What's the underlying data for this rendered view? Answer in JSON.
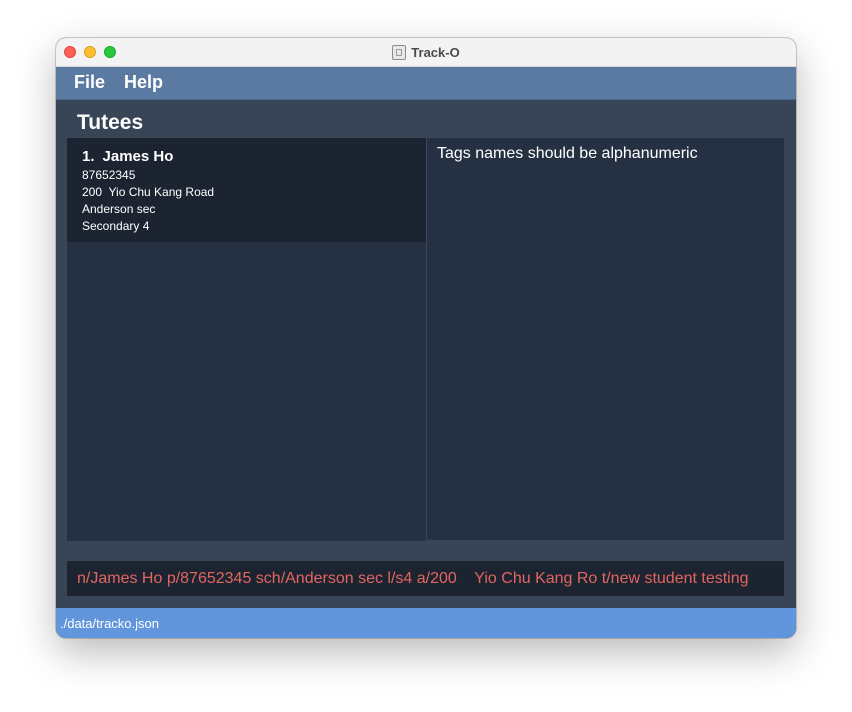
{
  "window": {
    "title": "Track-O"
  },
  "menubar": {
    "items": [
      {
        "label": "File"
      },
      {
        "label": "Help"
      }
    ]
  },
  "tutees_panel": {
    "heading": "Tutees",
    "tutees": [
      {
        "index": "1.",
        "name": "James Ho",
        "phone": "87652345",
        "address": "200  Yio Chu Kang Road",
        "school": "Anderson sec",
        "level": "Secondary 4"
      }
    ]
  },
  "result_display": {
    "message": "Tags names should be alphanumeric"
  },
  "command_box": {
    "value": "n/James Ho p/87652345 sch/Anderson sec l/s4 a/200    Yio Chu Kang Ro t/new student testing",
    "text_color": "#e2665f"
  },
  "status_bar": {
    "file_path": "./data/tracko.json"
  },
  "colors": {
    "menubar": "#5b7aa1",
    "background": "#374556",
    "panel": "#253142",
    "card": "#1c2331",
    "status_bar": "#6195dc"
  }
}
